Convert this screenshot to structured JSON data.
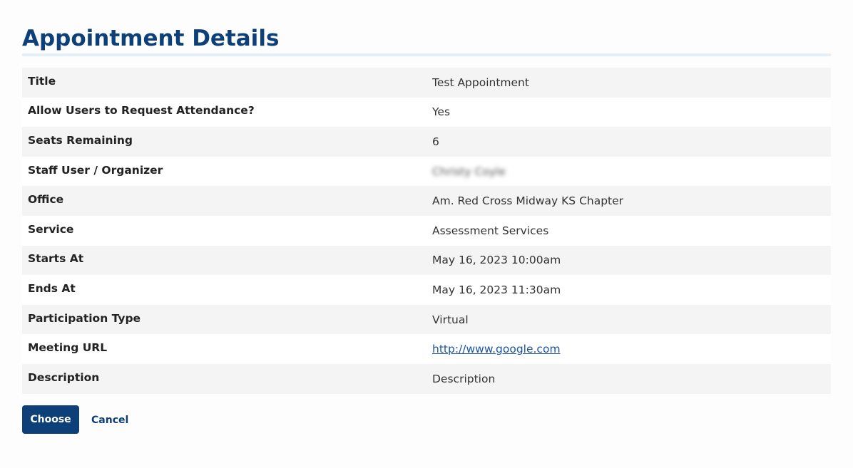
{
  "page": {
    "title": "Appointment Details"
  },
  "details": [
    {
      "label": "Title",
      "value": "Test Appointment"
    },
    {
      "label": "Allow Users to Request Attendance?",
      "value": "Yes"
    },
    {
      "label": "Seats Remaining",
      "value": "6"
    },
    {
      "label": "Staff User / Organizer",
      "value": "Christy Coyle"
    },
    {
      "label": "Office",
      "value": "Am. Red Cross Midway KS Chapter"
    },
    {
      "label": "Service",
      "value": "Assessment Services"
    },
    {
      "label": "Starts At",
      "value": "May 16, 2023 10:00am"
    },
    {
      "label": "Ends At",
      "value": "May 16, 2023 11:30am"
    },
    {
      "label": "Participation Type",
      "value": "Virtual"
    },
    {
      "label": "Meeting URL",
      "value": "http://www.google.com"
    },
    {
      "label": "Description",
      "value": "Description"
    }
  ],
  "actions": {
    "choose_label": "Choose",
    "cancel_label": "Cancel"
  },
  "colors": {
    "primary": "#0d3f78",
    "link": "#1a55a5",
    "row_stripe": "#f4f4f4",
    "title_rule": "#e3effb"
  }
}
